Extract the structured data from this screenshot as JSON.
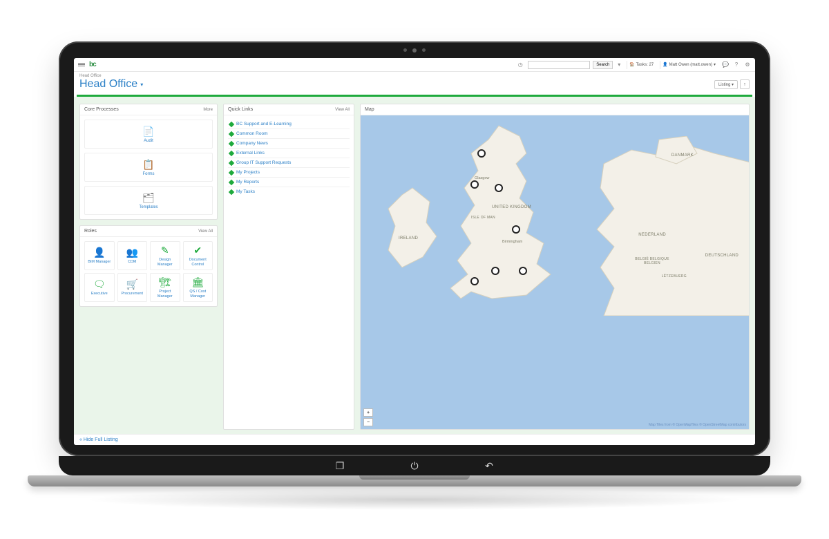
{
  "topbar": {
    "search_placeholder": "",
    "search_button": "Search",
    "tasks_label": "Tasks: 27",
    "user_label": "Matt Owen (matt.owen)",
    "caret": "▾"
  },
  "breadcrumb": "Head Office",
  "page_title": "Head Office",
  "listing_button": "Listing ▾",
  "panels": {
    "core": {
      "title": "Core Processes",
      "more": "More"
    },
    "roles": {
      "title": "Roles",
      "more": "View All"
    },
    "quicklinks": {
      "title": "Quick Links",
      "more": "View All"
    },
    "map": {
      "title": "Map"
    }
  },
  "core_processes": [
    {
      "label": "Audit",
      "icon": "📄"
    },
    {
      "label": "Forms",
      "icon": "📋"
    },
    {
      "label": "Templates",
      "icon": "🗂"
    }
  ],
  "roles": [
    {
      "label": "BIM Manager",
      "icon": "👤"
    },
    {
      "label": "CDM",
      "icon": "👥"
    },
    {
      "label": "Design Manager",
      "icon": "✎"
    },
    {
      "label": "Document Control",
      "icon": "✔"
    },
    {
      "label": "Executive",
      "icon": "🗨"
    },
    {
      "label": "Procurement",
      "icon": "🛒"
    },
    {
      "label": "Project Manager",
      "icon": "🏗"
    },
    {
      "label": "QS / Cost Manager",
      "icon": "🏛"
    }
  ],
  "quicklinks": [
    "BC Support and E-Learning",
    "Common Room",
    "Company News",
    "External Links",
    "Group IT Support Requests",
    "My Projects",
    "My Reports",
    "My Tasks"
  ],
  "map": {
    "labels": {
      "uk": "UNITED KINGDOM",
      "ireland": "IRELAND",
      "isle_of_man": "ISLE OF MAN",
      "danmark": "DANMARK",
      "nederland": "NEDERLAND",
      "belgie": "BELGIË BELGIQUE BELGIEN",
      "lux": "LËTZEBUERG",
      "deutschland": "DEUTSCHLAND",
      "glasgow": "Glasgow",
      "birmingham": "Birmingham"
    },
    "credit": "Map Tiles from © OpenMapTiles © OpenStreetMap contributors",
    "zoom_in": "+",
    "zoom_out": "−"
  },
  "footer_link": "« Hide Full Listing"
}
